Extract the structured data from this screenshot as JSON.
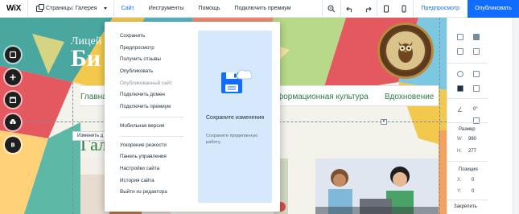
{
  "topbar": {
    "logo": "WiX",
    "pages_label": "Страницы: Галерея",
    "nav": [
      "Сайт",
      "Инструменты",
      "Помощь",
      "Подключить премиум"
    ],
    "preview_label": "Предпросмотр",
    "publish_label": "Опубликовать"
  },
  "site_menu": {
    "group1": [
      "Сохранить",
      "Предпросмотр",
      "Получить отзывы",
      "Опубликовать",
      "Опубликованный сайт",
      "Подключить домен",
      "Подключить премиум"
    ],
    "group2": [
      "Мобильная версия"
    ],
    "group3": [
      "Ускорение резкости",
      "Панель управления",
      "Настройки сайта",
      "История сайта",
      "Выйти из редактора"
    ],
    "panel_title": "Сохраните изменения",
    "panel_subtitle": "Сохраните проделанную работу."
  },
  "site": {
    "hero_line1": "Лицей",
    "hero_line2": "Би",
    "nav_items": [
      "Главная",
      "формационная культура",
      "Вдохновение"
    ],
    "change_label": "Изменить д",
    "gallery_title": "Гал"
  },
  "inspector": {
    "size_label": "Размер",
    "width_key": "W:",
    "width_value": "980",
    "height_key": "H:",
    "height_value": "277",
    "position_label": "Позиция",
    "x_key": "X:",
    "x_value": "0",
    "y_key": "Y:",
    "y_value": "0",
    "pin_label": "Закрепить",
    "angle_value": "0°"
  },
  "colors": {
    "accent": "#116dff",
    "site_green": "#2d7a45",
    "panel_blue": "#d6e8fb"
  }
}
